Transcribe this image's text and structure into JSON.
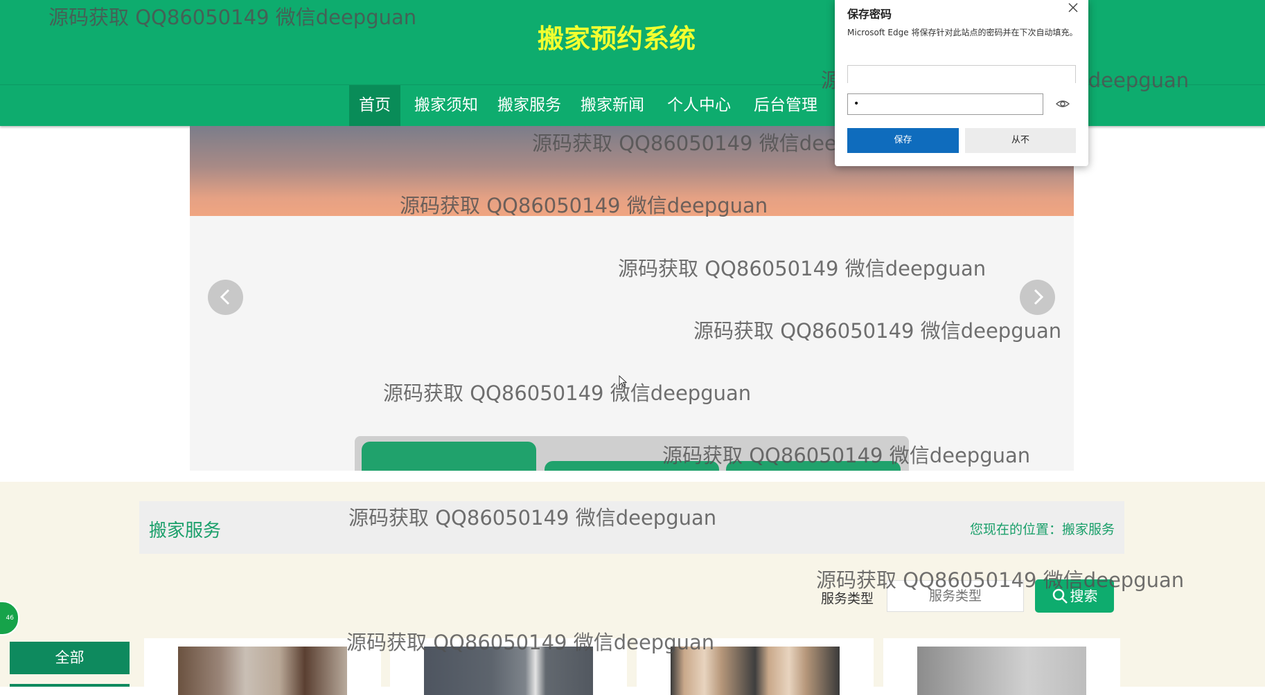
{
  "header": {
    "title": "搬家预约系统"
  },
  "nav": {
    "items": [
      "首页",
      "搬家须知",
      "搬家服务",
      "搬家新闻",
      "个人中心",
      "后台管理"
    ]
  },
  "banner": {
    "prev_icon": "chevron-left-icon",
    "next_icon": "chevron-right-icon"
  },
  "section": {
    "title": "搬家服务",
    "breadcrumb_prefix": "您现在的位置：",
    "breadcrumb_current": "搬家服务"
  },
  "filter": {
    "label": "服务类型",
    "placeholder": "服务类型",
    "search_label": "搜索",
    "search_icon": "search-icon"
  },
  "sidebar": {
    "all_label": "全部"
  },
  "float_badge": "46",
  "password_dialog": {
    "title": "保存密码",
    "description": "Microsoft Edge 将保存针对此站点的密码并在下次自动填充。",
    "password_value": "•",
    "save_label": "保存",
    "never_label": "从不",
    "eye_icon": "eye-icon",
    "close_icon": "close-icon"
  },
  "watermark": "源码获取 QQ86050149 微信deepguan",
  "colors": {
    "primary": "#0eac6e",
    "title": "#f2ff30",
    "accent_text": "#1a9f6a",
    "dialog_save": "#0f6cbd"
  }
}
